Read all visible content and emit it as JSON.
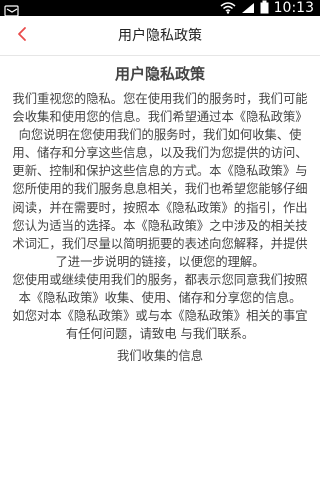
{
  "status_bar": {
    "time": "10:13",
    "icons": [
      "notification-icon",
      "wifi-icon",
      "signal-icon",
      "battery-icon"
    ]
  },
  "header": {
    "title": "用户隐私政策",
    "back_icon": "chevron-left-icon",
    "accent_color": "#e94b4b"
  },
  "document": {
    "title": "用户隐私政策",
    "paragraphs": [
      "我们重视您的隐私。您在使用我们的服务时，我们可能会收集和使用您的信息。我们希望通过本《隐私政策》向您说明在您使用我们的服务时，我们如何收集、使用、储存和分享这些信息，以及我们为您提供的访问、更新、控制和保护这些信息的方式。本《隐私政策》与您所使用的我们服务息息相关，我们也希望您能够仔细阅读，并在需要时，按照本《隐私政策》的指引，作出您认为适当的选择。本《隐私政策》之中涉及的相关技术词汇，我们尽量以简明扼要的表述向您解释，并提供了进一步说明的链接，以便您的理解。",
      "您使用或继续使用我们的服务，都表示您同意我们按照本《隐私政策》收集、使用、储存和分享您的信息。",
      "如您对本《隐私政策》或与本《隐私政策》相关的事宜有任何问题，请致电 与我们联系。"
    ],
    "next_section": "我们收集的信息"
  }
}
